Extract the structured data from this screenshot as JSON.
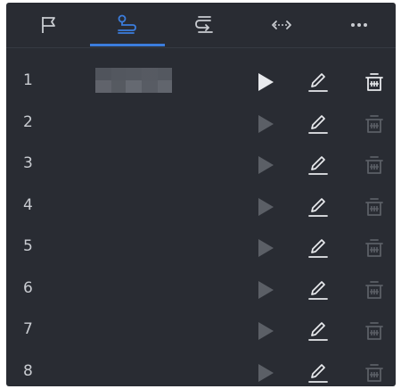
{
  "tabs": [
    {
      "id": "flag",
      "icon": "flag-icon",
      "active": false
    },
    {
      "id": "route",
      "icon": "route-icon",
      "active": true
    },
    {
      "id": "loop",
      "icon": "loop-return-icon",
      "active": false
    },
    {
      "id": "swap",
      "icon": "horizontal-arrows-icon",
      "active": false
    },
    {
      "id": "more",
      "icon": "more-dots-icon",
      "active": false
    }
  ],
  "rows": [
    {
      "number": "1",
      "name_blurred": true,
      "play_enabled": true,
      "delete_enabled": true
    },
    {
      "number": "2",
      "name_blurred": false,
      "play_enabled": false,
      "delete_enabled": false
    },
    {
      "number": "3",
      "name_blurred": false,
      "play_enabled": false,
      "delete_enabled": false
    },
    {
      "number": "4",
      "name_blurred": false,
      "play_enabled": false,
      "delete_enabled": false
    },
    {
      "number": "5",
      "name_blurred": false,
      "play_enabled": false,
      "delete_enabled": false
    },
    {
      "number": "6",
      "name_blurred": false,
      "play_enabled": false,
      "delete_enabled": false
    },
    {
      "number": "7",
      "name_blurred": false,
      "play_enabled": false,
      "delete_enabled": false
    },
    {
      "number": "8",
      "name_blurred": false,
      "play_enabled": false,
      "delete_enabled": false
    }
  ],
  "colors": {
    "panel_bg": "#292c33",
    "accent": "#3b7ddd",
    "icon_light": "#e8eaed",
    "icon_disabled": "#5b5f66",
    "text": "#c9ccd1"
  }
}
